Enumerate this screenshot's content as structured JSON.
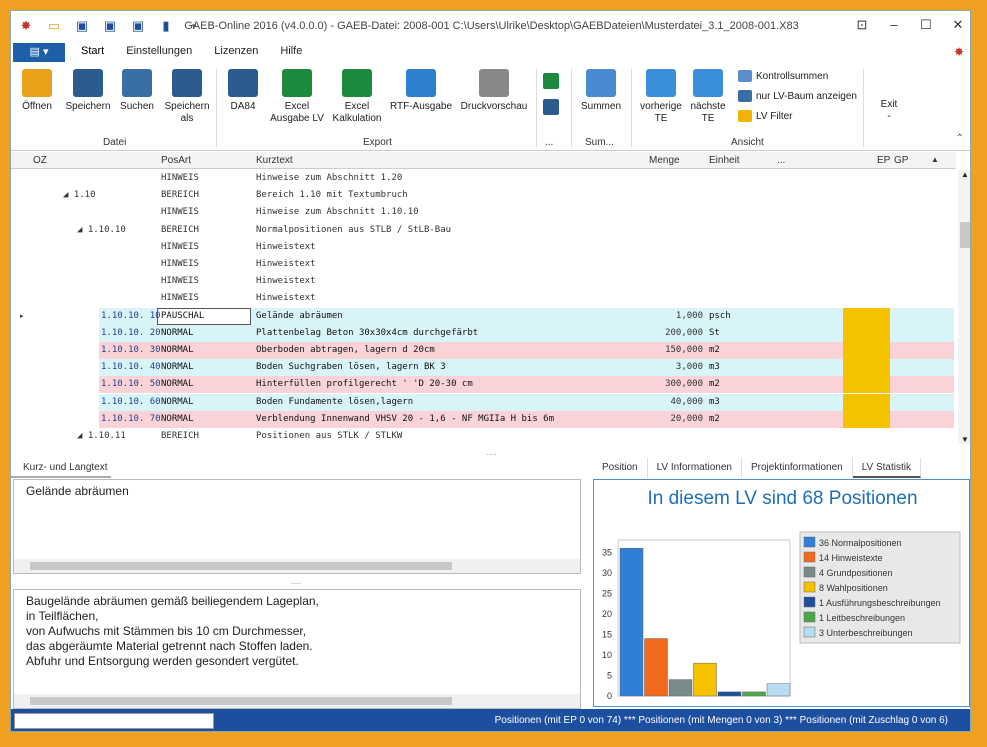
{
  "window": {
    "title": "GAEB-Online 2016 (v4.0.0.0) - GAEB-Datei: 2008-001 C:\\Users\\Ulrike\\Desktop\\GAEBDateien\\Musterdatei_3.1_2008-001.X83"
  },
  "menu": {
    "tabs": [
      "Start",
      "Einstellungen",
      "Lizenzen",
      "Hilfe"
    ]
  },
  "ribbon": {
    "buttons": [
      {
        "label": "Öffnen",
        "icon": "folder-open-icon",
        "color": "#e8a21a"
      },
      {
        "label": "Speichern",
        "icon": "save-icon",
        "color": "#2c5c8f"
      },
      {
        "label": "Suchen",
        "icon": "binoculars-icon",
        "color": "#3a6fa6"
      },
      {
        "label": "Speichern\nals",
        "icon": "save-as-icon",
        "color": "#2c5c8f"
      },
      {
        "label": "DA84",
        "icon": "save-da84-icon",
        "color": "#2c5c8f"
      },
      {
        "label": "Excel\nAusgabe LV",
        "icon": "excel-icon",
        "color": "#1e8a3e"
      },
      {
        "label": "Excel\nKalkulation",
        "icon": "excel-calc-icon",
        "color": "#1e8a3e"
      },
      {
        "label": "RTF-Ausgabe",
        "icon": "rtf-icon",
        "color": "#2f7fcf"
      },
      {
        "label": "Druckvorschau",
        "icon": "printer-icon",
        "color": "#888888"
      },
      {
        "label": "Summen",
        "icon": "paperclip-icon",
        "color": "#4a8ad0"
      },
      {
        "label": "vorherige\nTE",
        "icon": "arrow-left-icon",
        "color": "#3a8fd8"
      },
      {
        "label": "nächste\nTE",
        "icon": "arrow-right-icon",
        "color": "#3a8fd8"
      },
      {
        "label": "Exit\n-",
        "icon": "",
        "color": ""
      }
    ],
    "small_buttons": [
      "Kontrollsummen",
      "nur LV-Baum anzeigen",
      "LV Filter"
    ],
    "groups": [
      "Datei",
      "Export",
      "...",
      "Sum...",
      "Ansicht"
    ]
  },
  "grid": {
    "headers": [
      "OZ",
      "PosArt",
      "Kurztext",
      "Menge",
      "Einheit",
      "...",
      "EP",
      "GP"
    ],
    "rows": [
      {
        "oz": "",
        "posart": "HINWEIS",
        "text": "Hinweise zum Abschnitt 1.20",
        "menge": "",
        "einheit": "",
        "style": ""
      },
      {
        "oz": "◢ 1.10",
        "posart": "BEREICH",
        "text": "Bereich 1.10 mit Textumbruch",
        "menge": "",
        "einheit": "",
        "style": ""
      },
      {
        "oz": "",
        "posart": "HINWEIS",
        "text": "Hinweise zum Abschnitt 1.10.10",
        "menge": "",
        "einheit": "",
        "style": ""
      },
      {
        "oz": "◢ 1.10.10",
        "posart": "BEREICH",
        "text": "Normalpositionen aus STLB / StLB-Bau",
        "menge": "",
        "einheit": "",
        "style": ""
      },
      {
        "oz": "",
        "posart": "HINWEIS",
        "text": "Hinweistext",
        "menge": "",
        "einheit": "",
        "style": ""
      },
      {
        "oz": "",
        "posart": "HINWEIS",
        "text": "Hinweistext",
        "menge": "",
        "einheit": "",
        "style": ""
      },
      {
        "oz": "",
        "posart": "HINWEIS",
        "text": "Hinweistext",
        "menge": "",
        "einheit": "",
        "style": ""
      },
      {
        "oz": "",
        "posart": "HINWEIS",
        "text": "Hinweistext",
        "menge": "",
        "einheit": "",
        "style": ""
      },
      {
        "oz": "1.10.10. 10",
        "posart": "PAUSCHAL",
        "text": "Gelände abräumen",
        "menge": "1,000",
        "einheit": "psch",
        "style": "blue"
      },
      {
        "oz": "1.10.10. 20",
        "posart": "NORMAL",
        "text": "Plattenbelag Beton 30x30x4cm durchgefärbt",
        "menge": "200,000",
        "einheit": "St",
        "style": "blue"
      },
      {
        "oz": "1.10.10. 30",
        "posart": "NORMAL",
        "text": "Oberboden abtragen, lagern d 20cm",
        "menge": "150,000",
        "einheit": "m2",
        "style": "red"
      },
      {
        "oz": "1.10.10. 40",
        "posart": "NORMAL",
        "text": "Boden Suchgraben lösen, lagern BK 3",
        "menge": "3,000",
        "einheit": "m3",
        "style": "blue"
      },
      {
        "oz": "1.10.10. 50",
        "posart": "NORMAL",
        "text": "Hinterfüllen profilgerecht '                    'D 20-30 cm",
        "menge": "300,000",
        "einheit": "m2",
        "style": "red"
      },
      {
        "oz": "1.10.10. 60",
        "posart": "NORMAL",
        "text": "Boden Fundamente lösen,lagern",
        "menge": "40,000",
        "einheit": "m3",
        "style": "blue"
      },
      {
        "oz": "1.10.10. 70",
        "posart": "NORMAL",
        "text": "Verblendung Innenwand VHSV 20 - 1,6 - NF MGIIa H bis 6m",
        "menge": "20,000",
        "einheit": "m2",
        "style": "red"
      },
      {
        "oz": "◢ 1.10.11",
        "posart": "BEREICH",
        "text": "Positionen aus STLK / STLKW",
        "menge": "",
        "einheit": "",
        "style": ""
      }
    ]
  },
  "left_pane": {
    "tab": "Kurz- und Langtext",
    "short_text": "Gelände abräumen",
    "long_text": "Baugelände abräumen gemäß beiliegendem Lageplan,\nin Teilflächen,\nvon Aufwuchs mit Stämmen bis 10 cm Durchmesser,\ndas abgeräumte Material getrennt nach Stoffen laden.\nAbfuhr und Entsorgung werden gesondert vergütet."
  },
  "right_pane": {
    "tabs": [
      "Position",
      "LV Informationen",
      "Projektinformationen",
      "LV Statistik"
    ],
    "active_tab": "LV Statistik",
    "title": "In diesem LV sind 68 Positionen"
  },
  "chart_data": {
    "type": "bar",
    "title": "In diesem LV sind 68 Positionen",
    "categories": [
      "Normalpositionen",
      "Hinweistexte",
      "Grundpositionen",
      "Wahlpositionen",
      "Ausführungsbeschreibungen",
      "Leitbeschreibungen",
      "Unterbeschreibungen"
    ],
    "values": [
      36,
      14,
      4,
      8,
      1,
      1,
      3
    ],
    "legend": [
      "36 Normalpositionen",
      "14 Hinweistexte",
      "4 Grundpositionen",
      "8 Wahlpositionen",
      "1 Ausführungsbeschreibungen",
      "1 Leitbeschreibungen",
      "3 Unterbeschreibungen"
    ],
    "colors": [
      "#2f7fd8",
      "#f06a1e",
      "#7a8a8a",
      "#f5c200",
      "#1d4f9b",
      "#4aa84a",
      "#b8dcf4"
    ],
    "ylim": [
      0,
      38
    ],
    "yticks": [
      0,
      5,
      10,
      15,
      20,
      25,
      30,
      35
    ],
    "legend_position": "right"
  },
  "status": {
    "text": "Positionen (mit EP 0 von 74) *** Positionen (mit Mengen 0 von 3) *** Positionen (mit Zuschlag 0 von 6)"
  },
  "colors": {
    "accent": "#1d4fa0",
    "ep_highlight": "#f5c200",
    "row_blue": "#d8f4f8",
    "row_red": "#f9d3d6"
  }
}
